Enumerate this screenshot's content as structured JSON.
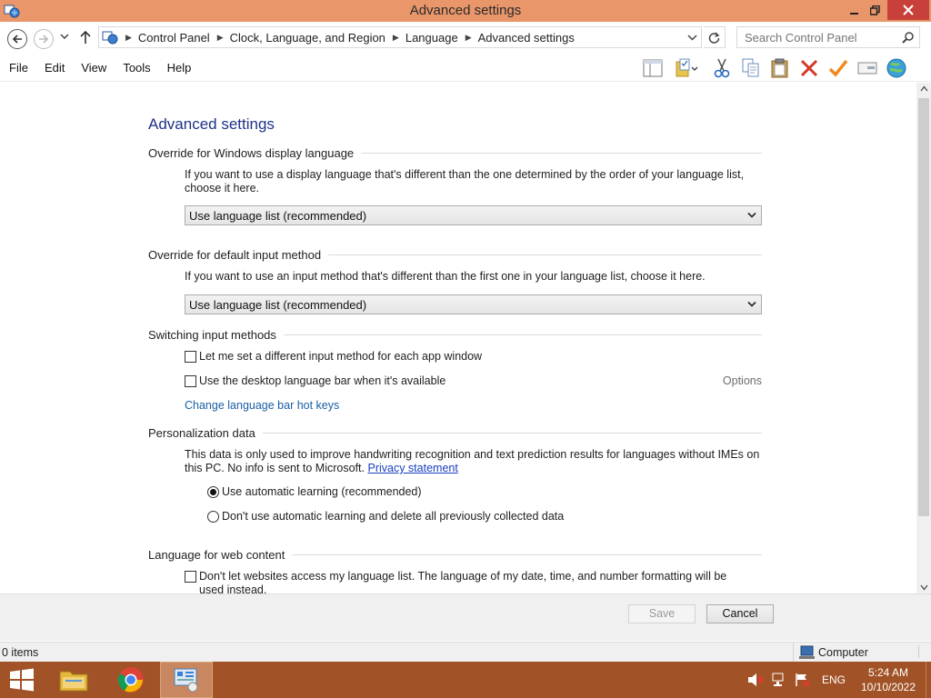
{
  "window": {
    "title": "Advanced settings"
  },
  "address": {
    "breadcrumbs": [
      "Control Panel",
      "Clock, Language, and Region",
      "Language",
      "Advanced settings"
    ],
    "search_placeholder": "Search Control Panel"
  },
  "menu": [
    "File",
    "Edit",
    "View",
    "Tools",
    "Help"
  ],
  "toolbar_icons": [
    "preview-pane-icon",
    "properties-icon",
    "cut-icon",
    "copy-icon",
    "paste-icon",
    "delete-icon",
    "checkmark-icon",
    "rename-icon",
    "globe-icon"
  ],
  "page": {
    "title": "Advanced settings",
    "display_language": {
      "heading": "Override for Windows display language",
      "description": "If you want to use a display language that's different than the one determined by the order of your language list, choose it here.",
      "selected": "Use language list (recommended)"
    },
    "input_method": {
      "heading": "Override for default input method",
      "description": "If you want to use an input method that's different than the first one in your language list, choose it here.",
      "selected": "Use language list (recommended)"
    },
    "switching": {
      "heading": "Switching input methods",
      "check_per_app": "Let me set a different input method for each app window",
      "check_per_app_checked": false,
      "check_language_bar": "Use the desktop language bar when it's available",
      "check_language_bar_checked": false,
      "options_label": "Options",
      "hotkeys_link": "Change language bar hot keys"
    },
    "personalization": {
      "heading": "Personalization data",
      "description": "This data is only used to improve handwriting recognition and text prediction results for languages without IMEs on this PC. No info is sent to Microsoft.",
      "privacy_link": "Privacy statement",
      "radio_auto": "Use automatic learning (recommended)",
      "radio_auto_selected": true,
      "radio_off": "Don't use automatic learning and delete all previously collected data",
      "radio_off_selected": false
    },
    "web_content": {
      "heading": "Language for web content",
      "check_label": "Don't let websites access my language list. The language of my date, time, and number formatting will be used instead.",
      "check_checked": false
    }
  },
  "buttons": {
    "save": "Save",
    "cancel": "Cancel"
  },
  "status": {
    "items": "0 items",
    "location": "Computer"
  },
  "taskbar": {
    "language": "ENG",
    "time": "5:24 AM",
    "date": "10/10/2022"
  },
  "colors": {
    "titlebar": "#e8966a",
    "taskbar": "#a15327",
    "heading_blue": "#1e3287",
    "link_blue": "#1a5fa5"
  }
}
